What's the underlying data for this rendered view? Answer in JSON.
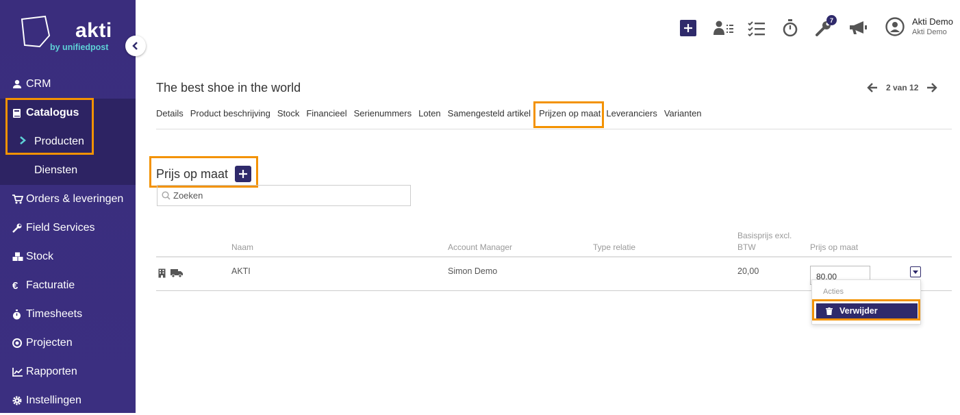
{
  "brand": {
    "name": "akti",
    "sub": "by unifiedpost"
  },
  "sidebar": {
    "items": [
      {
        "label": "CRM",
        "icon": "user-icon"
      },
      {
        "label": "Catalogus",
        "icon": "book-icon"
      },
      {
        "label": "Producten"
      },
      {
        "label": "Diensten"
      },
      {
        "label": "Orders & leveringen",
        "icon": "cart-icon"
      },
      {
        "label": "Field Services",
        "icon": "wrench-icon"
      },
      {
        "label": "Stock",
        "icon": "cubes-icon"
      },
      {
        "label": "Facturatie",
        "icon": "euro-icon"
      },
      {
        "label": "Timesheets",
        "icon": "stopwatch-icon"
      },
      {
        "label": "Projecten",
        "icon": "target-icon"
      },
      {
        "label": "Rapporten",
        "icon": "chart-icon"
      },
      {
        "label": "Instellingen",
        "icon": "gear-icon"
      }
    ]
  },
  "header": {
    "notification_count": "7",
    "user_name": "Akti Demo",
    "user_company": "Akti Demo"
  },
  "page": {
    "title": "The best shoe in the world",
    "pager": "2 van 12",
    "tabs": [
      "Details",
      "Product beschrijving",
      "Stock",
      "Financieel",
      "Serienummers",
      "Loten",
      "Samengesteld artikel",
      "Prijzen op maat",
      "Leveranciers",
      "Varianten"
    ]
  },
  "section": {
    "title": "Prijs op maat",
    "search_placeholder": "Zoeken"
  },
  "table": {
    "columns": {
      "naam": "Naam",
      "account_manager": "Account Manager",
      "type_relatie": "Type relatie",
      "basisprijs_line1": "Basisprijs excl.",
      "basisprijs_line2": "BTW",
      "prijs_op_maat": "Prijs op maat"
    },
    "rows": [
      {
        "naam": "AKTI",
        "account_manager": "Simon Demo",
        "type_relatie": "",
        "basisprijs": "20,00",
        "prijs_op_maat": "80.00"
      }
    ]
  },
  "dropdown": {
    "header": "Acties",
    "delete_label": "Verwijder"
  },
  "colors": {
    "sidebar": "#3a2d7d",
    "accent": "#2f2a6b",
    "highlight": "#f39200",
    "brand_sub": "#5ed1d6"
  }
}
